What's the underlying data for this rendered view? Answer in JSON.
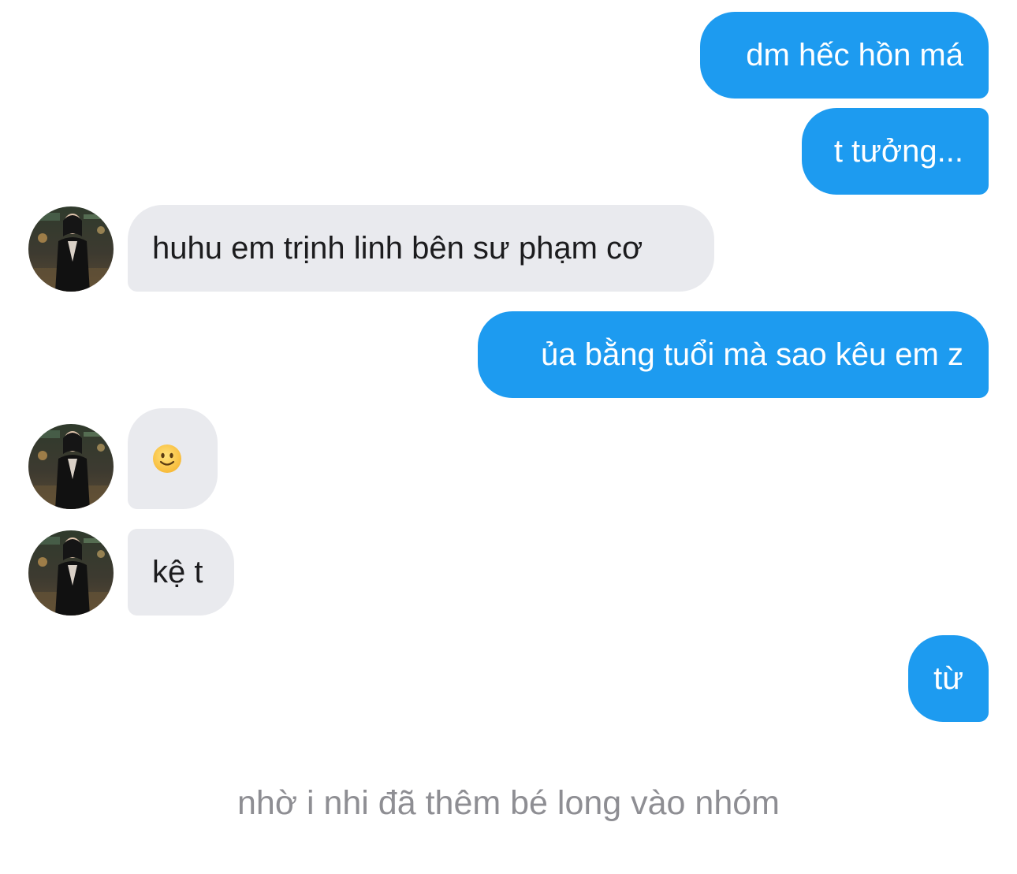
{
  "messages": [
    {
      "side": "outgoing",
      "text": "dm hếc hồn má"
    },
    {
      "side": "outgoing",
      "text": "t tưởng..."
    },
    {
      "side": "incoming",
      "text": "huhu em trịnh linh bên sư phạm cơ"
    },
    {
      "side": "outgoing",
      "text": "ủa bằng tuổi mà sao kêu em z"
    },
    {
      "side": "incoming",
      "text": "",
      "icon": "slightly-smiling-face-emoji"
    },
    {
      "side": "incoming",
      "text": "kệ t"
    },
    {
      "side": "outgoing",
      "text": "từ"
    }
  ],
  "system_notice": "nhờ i nhi đã thêm bé long vào nhóm",
  "colors": {
    "outgoing_bubble": "#1d9bf0",
    "incoming_bubble": "#e9eaee",
    "system_text": "#8e8e93"
  },
  "icons": {
    "avatar": "contact-avatar-photo",
    "emoji": "slightly-smiling-face-emoji"
  }
}
